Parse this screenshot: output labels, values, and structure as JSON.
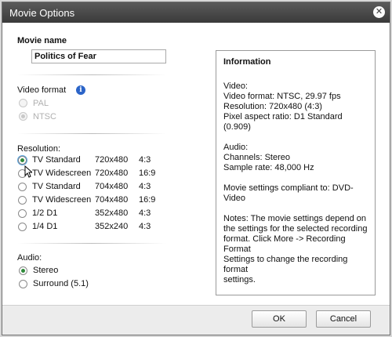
{
  "window": {
    "title": "Movie Options",
    "close_glyph": "✕"
  },
  "movie_name": {
    "label": "Movie name",
    "value": "Politics of Fear"
  },
  "video_format": {
    "label": "Video format",
    "info_icon": "info-icon",
    "options": [
      {
        "label": "PAL",
        "checked": false,
        "enabled": false
      },
      {
        "label": "NTSC",
        "checked": true,
        "enabled": false
      }
    ]
  },
  "resolution": {
    "label": "Resolution:",
    "options": [
      {
        "name": "TV Standard",
        "size": "720x480",
        "aspect": "4:3",
        "checked": true
      },
      {
        "name": "TV Widescreen",
        "size": "720x480",
        "aspect": "16:9",
        "checked": false
      },
      {
        "name": "TV Standard",
        "size": "704x480",
        "aspect": "4:3",
        "checked": false
      },
      {
        "name": "TV Widescreen",
        "size": "704x480",
        "aspect": "16:9",
        "checked": false
      },
      {
        "name": "1/2 D1",
        "size": "352x480",
        "aspect": "4:3",
        "checked": false
      },
      {
        "name": "1/4 D1",
        "size": "352x240",
        "aspect": "4:3",
        "checked": false
      }
    ]
  },
  "audio": {
    "label": "Audio:",
    "options": [
      {
        "label": "Stereo",
        "checked": true
      },
      {
        "label": "Surround (5.1)",
        "checked": false
      }
    ]
  },
  "information": {
    "title": "Information",
    "video": [
      "Video:",
      "Video format: NTSC, 29.97 fps",
      "Resolution: 720x480 (4:3)",
      "Pixel aspect ratio: D1 Standard (0.909)"
    ],
    "audio": [
      "Audio:",
      "Channels: Stereo",
      "Sample rate: 48,000 Hz"
    ],
    "compliance": [
      "Movie settings compliant to: DVD-",
      "Video"
    ],
    "notes": [
      "Notes: The movie settings depend on",
      "the settings for the selected recording",
      "format. Click More -> Recording Format",
      "Settings to change the recording format",
      "settings."
    ]
  },
  "buttons": {
    "ok": "OK",
    "cancel": "Cancel"
  }
}
